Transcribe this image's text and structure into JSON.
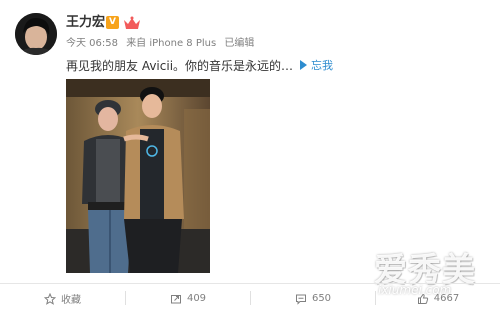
{
  "post": {
    "username": "王力宏",
    "verified_badge": "V",
    "meta": {
      "time": "今天 06:58",
      "source": "来自 iPhone 8 Plus",
      "edited": "已编辑"
    },
    "text": "再见我的朋友 Avicii。你的音乐是永远的…",
    "translate_label": "忘我",
    "photo_alt": "Two men posing together in front of a wall"
  },
  "watermark": {
    "big": "爱秀美",
    "small": "ixiumei.com"
  },
  "actions": [
    {
      "key": "favorite",
      "label": "收藏",
      "icon": "star-icon"
    },
    {
      "key": "repost",
      "label": "409",
      "icon": "repost-icon"
    },
    {
      "key": "comment",
      "label": "650",
      "icon": "comment-icon"
    },
    {
      "key": "like",
      "label": "4667",
      "icon": "thumbs-up-icon"
    }
  ],
  "colors": {
    "badge": "#f7a31b",
    "link": "#2d8ccf",
    "text": "#333333",
    "meta": "#808080"
  }
}
